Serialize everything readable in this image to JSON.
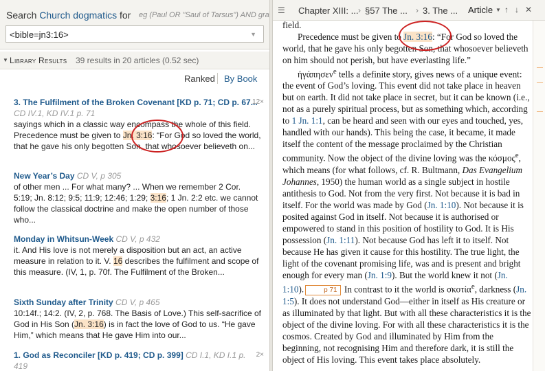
{
  "search": {
    "prefix": "Search",
    "resource": "Church dogmatics",
    "for": "for",
    "hint": "eg (Paul OR \"Saul of Tarsus\") AND grace",
    "value": "<bible=jn3:16>"
  },
  "results": {
    "header": "Library Results",
    "count": "39 results in 20 articles (0.52 sec)",
    "sort_ranked": "Ranked",
    "sort_by_book": "By Book",
    "items": [
      {
        "title": "3. The Fulfilment of the Broken Covenant [KD p. 71; CD p. 67...",
        "source": "CD IV.1, KD IV.1 p. 71",
        "hits": "12×",
        "snippet_a": "sayings which in a classic way encompass the whole of this field. Precedence must be given to ",
        "snippet_hl": "Jn. 3:16",
        "snippet_b": ": “For God so loved the world, that he gave his only begotten Son, that whosoever believeth on..."
      },
      {
        "title": "New Year’s Day",
        "source": "CD V, p 305",
        "hits": "",
        "snippet_a": "of other men ... For what many? ... When we remember 2 Cor. 5:19; Jn. 8:12; 9:5; 11:9; 12:46; 1:29; ",
        "snippet_hl": "3:16",
        "snippet_b": "; 1 Jn. 2:2 etc. we cannot follow the classical doctrine and make the open number of those who..."
      },
      {
        "title": "Monday in Whitsun-Week",
        "source": "CD V, p 432",
        "hits": "",
        "snippet_a": "it. And His love is not merely a disposition but an act, an active measure in relation to it. V. ",
        "snippet_hl": "16",
        "snippet_b": " describes the fulfilment and scope of this measure. (IV, 1, p. 70f. The Fulfilment of the Broken..."
      },
      {
        "title": "Sixth Sunday after Trinity",
        "source": "CD V, p 465",
        "hits": "",
        "snippet_a": "10:14f.; 14:2. (IV, 2, p. 768. The Basis of Love.) This self-sacrifice of God in His Son (",
        "snippet_hl": "Jn. 3:16",
        "snippet_b": ") is in fact the love of God to us. “He gave Him,” which means that He gave Him into our..."
      },
      {
        "title": "1. God as Reconciler [KD p. 419; CD p. 399]",
        "source": "CD I.1, KD I.1 p. 419",
        "hits": "2×",
        "snippet_a": "",
        "snippet_hl": "",
        "snippet_b": ""
      }
    ]
  },
  "reader": {
    "crumb1": "Chapter XIII: ...",
    "crumb2": "§57 The ...",
    "crumb3": "3. The ...",
    "view": "Article",
    "line0": "field.",
    "p1_a": "Precedence must be given to ",
    "p1_ref": "Jn. 3:16",
    "p1_b": ": “For God so loved the world, that he gave his only begotten Son, that whosoever believeth on him should not perish, but have everlasting life.”",
    "p2_a": "ἠγάπησεν",
    "p2_b": " tells a definite story, gives news of a unique event: the event of God’s loving. This event did not take place in heaven but on earth. It did not take place in secret, but it can be known (i.e., not as a purely spiritual process, but as something which, according to ",
    "p2_ref1": "1 Jn. 1:1",
    "p2_c": ", can be heard and seen with our eyes and touched, yes, handled with our hands). This being the case, it became, it made itself the content of the message proclaimed by the Christian community. Now the object of the divine loving was the κόσμος",
    "p2_d": ", which means (for what follows, cf. R. Bultmann, ",
    "p2_book": "Das Evangelium Johannes",
    "p2_e": ", 1950) the human world as a single subject in hostile antithesis to God. Not from the very first. Not because it is bad in itself. For the world was made by God (",
    "p2_ref2": "Jn. 1:10",
    "p2_f": "). Not because it is posited against God in itself. Not because it is authorised or empowered to stand in this position of hostility to God. It is His possession (",
    "p2_ref3": "Jn. 1:11",
    "p2_g": "). Not because God has left it to itself. Not because He has given it cause for this hostility. The true light, the light of the covenant promising life, was and is present and bright enough for every man (",
    "p2_ref4": "Jn. 1:9",
    "p2_h": "). But the world knew it not (",
    "p2_ref5": "Jn. 1:10",
    "p2_i": ").",
    "page_marker": "p 71",
    "p2_j": " In contrast to it the world is σκοτία",
    "p2_k": ", darkness (",
    "p2_ref6": "Jn. 1:5",
    "p2_l": "). It does not understand God—either in itself as His creature or as illuminated by that light. But with all these characteristics it is the object of the divine loving. For with all these characteristics it is the cosmos. Created by God and illuminated by Him from the beginning, not recognising Him and therefore dark, it is still the object of His loving. This event takes place absolutely."
  },
  "colors": {
    "link": "#1f5a8c",
    "highlight": "#fbe3c7",
    "annotation": "#cc2222",
    "chrome": "#f4f3ef"
  }
}
